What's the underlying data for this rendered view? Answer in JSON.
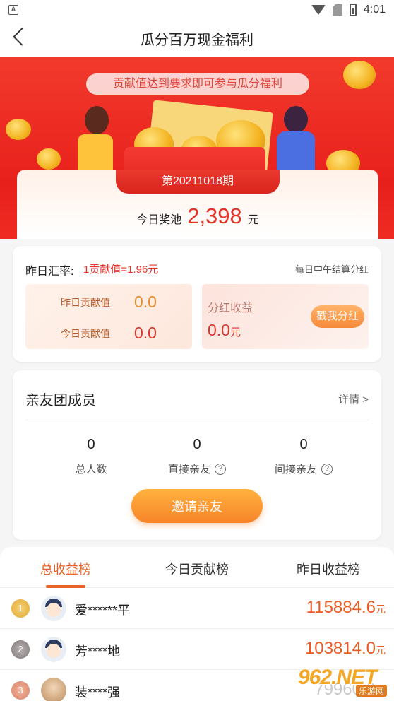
{
  "status_bar": {
    "time": "4:01",
    "a_badge": "A"
  },
  "header": {
    "title": "瓜分百万现金福利"
  },
  "banner": {
    "tip": "贡献值达到要求即可参与瓜分福利"
  },
  "pool": {
    "period": "第20211018期",
    "label": "今日奖池",
    "value": "2,398",
    "unit": "元"
  },
  "rate": {
    "label": "昨日汇率:",
    "value": "1贡献值=1.96元",
    "note": "每日中午结算分红",
    "yesterday_label": "昨日贡献值",
    "yesterday_value": "0.0",
    "today_label": "今日贡献值",
    "today_value": "0.0",
    "dividend_label": "分红收益",
    "dividend_value": "0.0",
    "dividend_unit": "元",
    "dividend_button": "戳我分红"
  },
  "team": {
    "title": "亲友团成员",
    "detail_link": "详情 >",
    "stats": [
      {
        "value": "0",
        "label": "总人数"
      },
      {
        "value": "0",
        "label": "直接亲友"
      },
      {
        "value": "0",
        "label": "间接亲友"
      }
    ],
    "invite_button": "邀请亲友"
  },
  "ranking": {
    "tabs": [
      "总收益榜",
      "今日贡献榜",
      "昨日收益榜"
    ],
    "rows": [
      {
        "rank": "1",
        "name": "爱******平",
        "amount": "115884.6",
        "unit": "元"
      },
      {
        "rank": "2",
        "name": "芳****地",
        "amount": "103814.0",
        "unit": "元"
      },
      {
        "rank": "3",
        "name": "装****强",
        "amount": "79960.0",
        "unit": "元"
      }
    ]
  },
  "watermark": {
    "main": "962.NET",
    "sub": "乐游网"
  }
}
